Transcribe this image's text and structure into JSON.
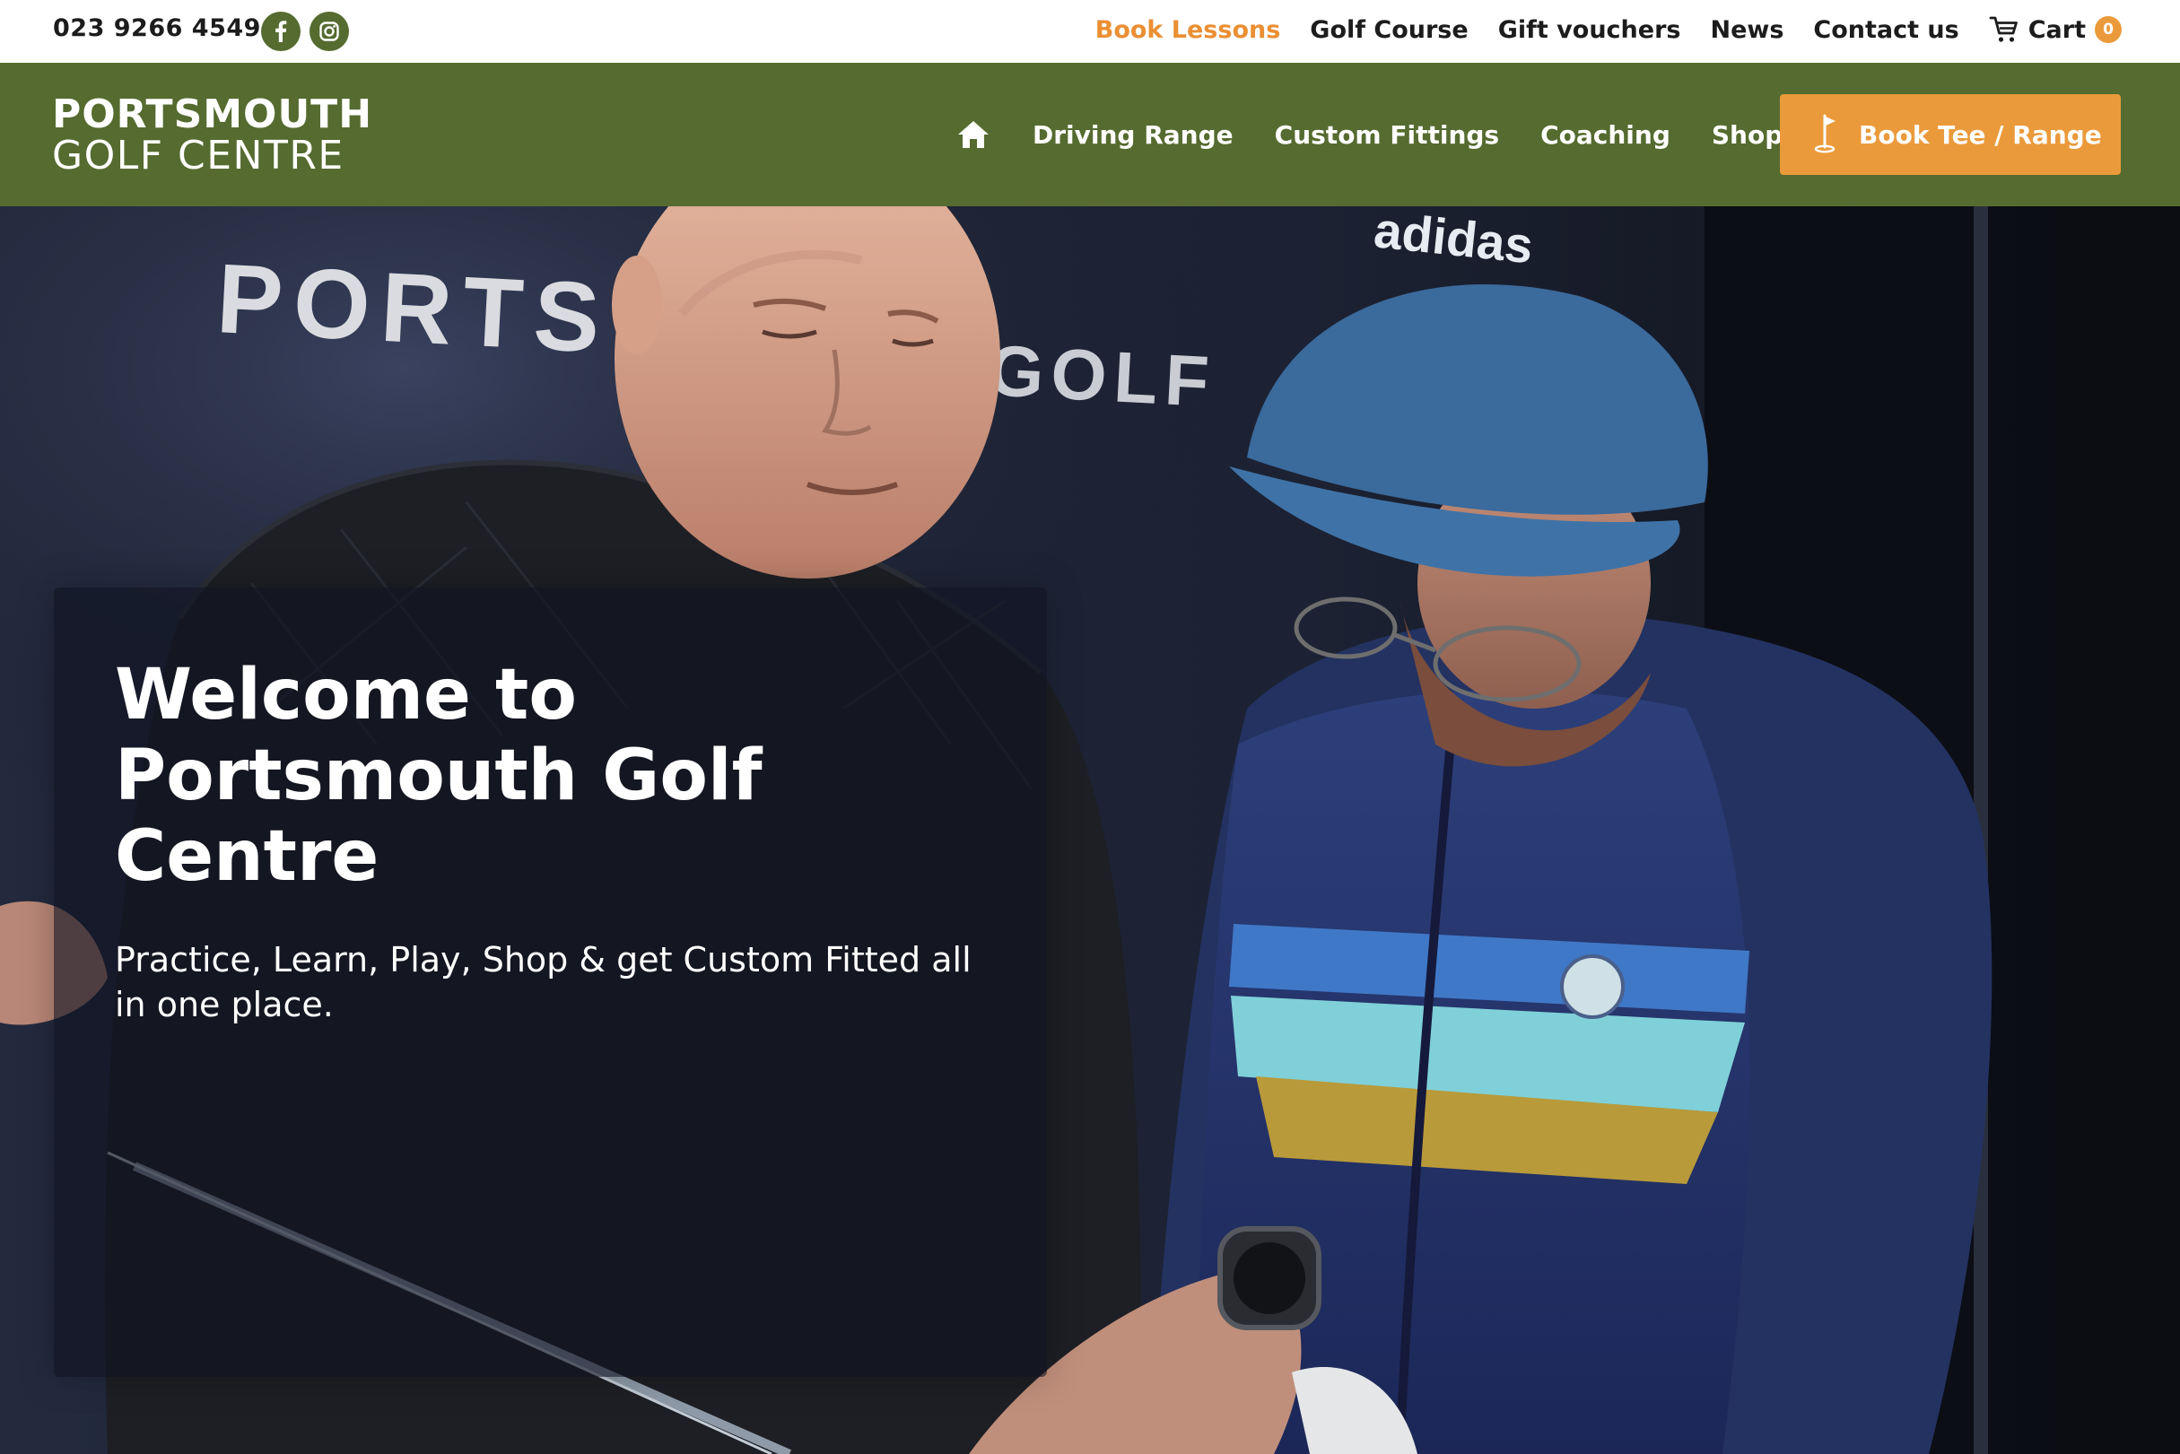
{
  "topbar": {
    "phone": "023 9266 4549",
    "social": [
      "facebook-icon",
      "instagram-icon"
    ],
    "links": {
      "book_lessons": "Book Lessons",
      "golf_course": "Golf Course",
      "gift_vouchers": "Gift vouchers",
      "news": "News",
      "contact": "Contact us",
      "cart": "Cart"
    },
    "cart_count": "0"
  },
  "header": {
    "logo_line1": "PORTSMOUTH",
    "logo_line2": "GOLF CENTRE",
    "nav": {
      "home_icon": "home-icon",
      "driving_range": "Driving Range",
      "custom_fittings": "Custom Fittings",
      "coaching": "Coaching",
      "shop": "Shop"
    },
    "cta": {
      "label": "Book Tee / Range",
      "icon": "golf-flag-icon"
    }
  },
  "hero": {
    "title": "Welcome to Portsmouth Golf Centre",
    "subtitle": "Practice, Learn, Play, Shop & get Custom Fitted all in one place.",
    "background_text_1": "PORTS",
    "background_text_2": "GOLF",
    "cap_text": "adidas"
  },
  "colors": {
    "brand_green": "#556b2f",
    "accent_orange": "#eb9a3b",
    "active_link": "#eb8f33",
    "text_dark": "#1c1c1c"
  }
}
